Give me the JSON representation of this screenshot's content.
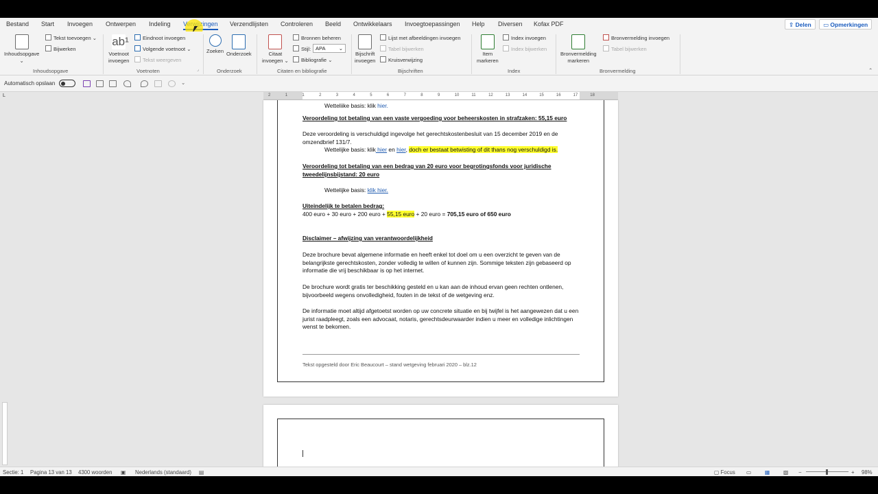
{
  "menu": {
    "tabs": [
      "Bestand",
      "Start",
      "Invoegen",
      "Ontwerpen",
      "Indeling",
      "Verwijzingen",
      "Verzendlijsten",
      "Controleren",
      "Beeld",
      "Ontwikkelaars",
      "Invoegtoepassingen",
      "Help",
      "Diversen",
      "Kofax PDF"
    ],
    "active_tab": "Verwijzingen",
    "share_label": "Delen",
    "comments_label": "Opmerkingen"
  },
  "ribbon": {
    "toc": {
      "big_label": "Inhoudsopgave",
      "add_text": "Tekst toevoegen",
      "update": "Bijwerken",
      "group": "Inhoudsopgave"
    },
    "footnotes": {
      "big_label_1": "Voetnoot",
      "big_label_2": "invoegen",
      "endnote": "Eindnoot invoegen",
      "next": "Volgende voetnoot",
      "show": "Tekst weergeven",
      "group": "Voetnoten"
    },
    "research": {
      "search": "Zoeken",
      "research": "Onderzoek",
      "group": "Onderzoek"
    },
    "citations": {
      "big_label_1": "Citaat",
      "big_label_2": "invoegen",
      "manage": "Bronnen beheren",
      "style_label": "Stijl:",
      "style_value": "APA",
      "bibliography": "Bibliografie",
      "group": "Citaten en bibliografie"
    },
    "captions": {
      "big_label_1": "Bijschrift",
      "big_label_2": "invoegen",
      "list": "Lijst met afbeeldingen invoegen",
      "update_table": "Tabel bijwerken",
      "crossref": "Kruisverwijzing",
      "group": "Bijschriften"
    },
    "index": {
      "big_label_1": "Item",
      "big_label_2": "markeren",
      "insert": "Index invoegen",
      "update": "Index bijwerken",
      "group": "Index"
    },
    "authorities": {
      "big_label_1": "Bronvermelding",
      "big_label_2": "markeren",
      "insert": "Bronvermelding invoegen",
      "update": "Tabel bijwerken",
      "group": "Bronvermelding"
    }
  },
  "qat": {
    "autosave_label": "Automatisch opslaan"
  },
  "document": {
    "top_line_prefix": "Wettelijke basis: klik ",
    "top_line_link": "hier.",
    "h1": "Veroordeling tot betaling van een vaste vergoeding voor beheerskosten in strafzaken: 55,15 euro",
    "p1": "Deze veroordeling is verschuldigd ingevolge het gerechtskostenbesluit van 15 december 2019 en de omzendbrief 131/7.",
    "basis_prefix": "Wettelijke basis: klik",
    "basis_link1": " hier",
    "basis_mid": " en ",
    "basis_link2": "hier",
    "basis_comma": ", ",
    "basis_highlight": "doch er bestaat betwisting of dit thans nog verschuldigd is.",
    "h2": "Veroordeling tot betaling van een bedrag van 20 euro voor begrotingsfonds voor juridische tweedelijnsbijstand: 20 euro",
    "basis2_prefix": "Wettelijke basis: ",
    "basis2_link": "klik hier.",
    "h3": "Uiteindelijk te betalen bedrag:",
    "sum_part1": "400 euro + 30 euro + 200 euro + ",
    "sum_highlight": "55,15 euro",
    "sum_part2": " + 20 euro = ",
    "sum_total": "705,15 euro of 650 euro",
    "h4": "Disclaimer – afwijzing van verantwoordelijkheid",
    "d1": "Deze brochure bevat algemene informatie en heeft enkel tot doel om u een overzicht te geven van de belangrijkste gerechtskosten, zonder volledig te willen of kunnen zijn. Sommige teksten zijn gebaseerd op informatie die vrij beschikbaar is op het internet.",
    "d2": "De brochure wordt gratis ter beschikking gesteld en u kan aan de inhoud ervan geen rechten ontlenen, bijvoorbeeld wegens onvolledigheid, fouten in de tekst of de wetgeving enz.",
    "d3": "De informatie moet altijd afgetoetst worden op uw concrete situatie en bij twijfel is het aangewezen dat u een jurist raadpleegt, zoals een advocaat, notaris, gerechtsdeurwaarder indien u meer en volledige inlichtingen wenst te bekomen.",
    "footer": "Tekst opgesteld door Eric Beaucourt – stand wetgeving februari 2020 – blz.12"
  },
  "ruler_numbers": [
    "2",
    "1",
    "1",
    "2",
    "3",
    "4",
    "5",
    "6",
    "7",
    "8",
    "9",
    "10",
    "11",
    "12",
    "13",
    "14",
    "15",
    "16",
    "17",
    "18"
  ],
  "statusbar": {
    "section": "Sectie: 1",
    "page": "Pagina 13 van 13",
    "words": "4300 woorden",
    "language": "Nederlands (standaard)",
    "focus": "Focus",
    "zoom": "98%"
  },
  "colors": {
    "accent": "#185abd",
    "highlight": "#ffff2e",
    "link": "#1f5bb0"
  }
}
